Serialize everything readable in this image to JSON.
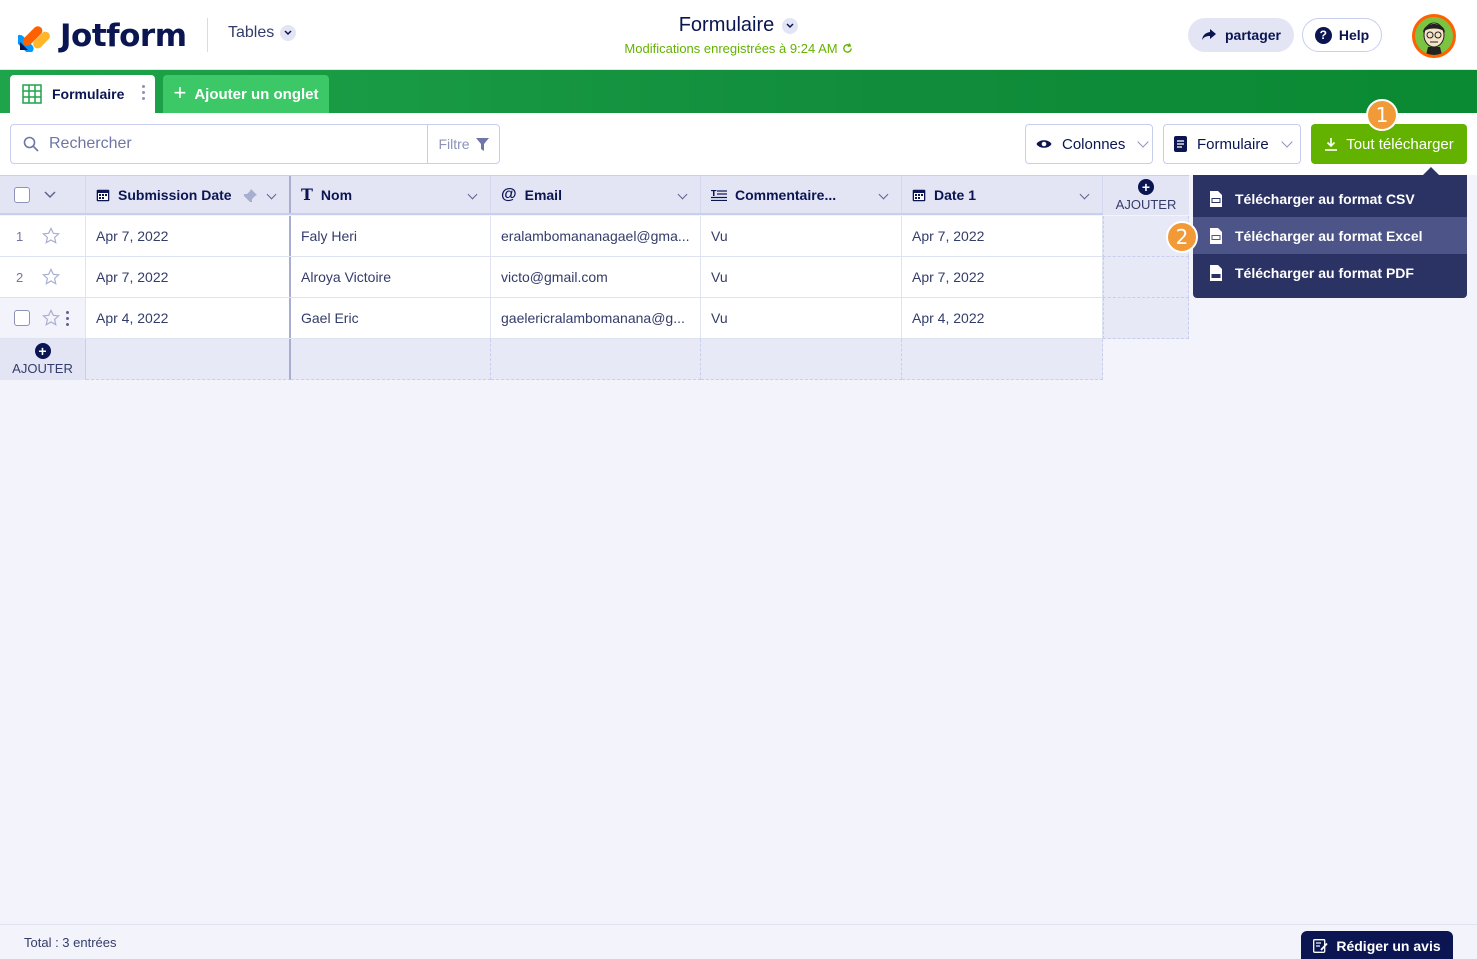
{
  "app": {
    "logo_text": "Jotform",
    "tables_label": "Tables"
  },
  "header": {
    "title": "Formulaire",
    "saved_status": "Modifications enregistrées à 9:24 AM",
    "share_label": "partager",
    "help_label": "Help"
  },
  "tabs": [
    {
      "label": "Formulaire"
    },
    {
      "label": "Ajouter un onglet"
    }
  ],
  "toolbar": {
    "search_placeholder": "Rechercher",
    "filter_label": "Filtre",
    "columns_label": "Colonnes",
    "form_label": "Formulaire",
    "download_label": "Tout télécharger"
  },
  "badges": {
    "first": "1",
    "second": "2"
  },
  "table": {
    "columns": [
      {
        "label": "Submission Date",
        "icon": "calendar-icon"
      },
      {
        "label": "Nom",
        "icon": "text-icon"
      },
      {
        "label": "Email",
        "icon": "at-icon"
      },
      {
        "label": "Commentaire...",
        "icon": "textarea-icon"
      },
      {
        "label": "Date 1",
        "icon": "calendar-icon"
      }
    ],
    "add_column_label": "AJOUTER",
    "add_row_label": "AJOUTER",
    "rows": [
      {
        "num": "1",
        "cells": [
          "Apr 7, 2022",
          "Faly Heri",
          "eralambomananagael@gma...",
          "Vu",
          "Apr 7, 2022"
        ]
      },
      {
        "num": "2",
        "cells": [
          "Apr 7, 2022",
          "Alroya Victoire",
          "victo@gmail.com",
          "Vu",
          "Apr 7, 2022"
        ]
      },
      {
        "num": "",
        "cells": [
          "Apr 4, 2022",
          "Gael Eric",
          "gaelericralambomanana@g...",
          "Vu",
          "Apr 4, 2022"
        ]
      }
    ]
  },
  "download_menu": [
    {
      "label": "Télécharger au format CSV",
      "icon": "csv-file-icon"
    },
    {
      "label": "Télécharger au format Excel",
      "icon": "xls-file-icon"
    },
    {
      "label": "Télécharger au format PDF",
      "icon": "pdf-file-icon"
    }
  ],
  "footer": {
    "total": "Total : 3 entrées",
    "review_label": "Rédiger un avis"
  },
  "colors": {
    "brand_navy": "#0a1551",
    "tab_green": "#1ea44a",
    "download_green": "#64b200",
    "badge_orange": "#f29a38",
    "menu_bg": "#2b3264"
  }
}
